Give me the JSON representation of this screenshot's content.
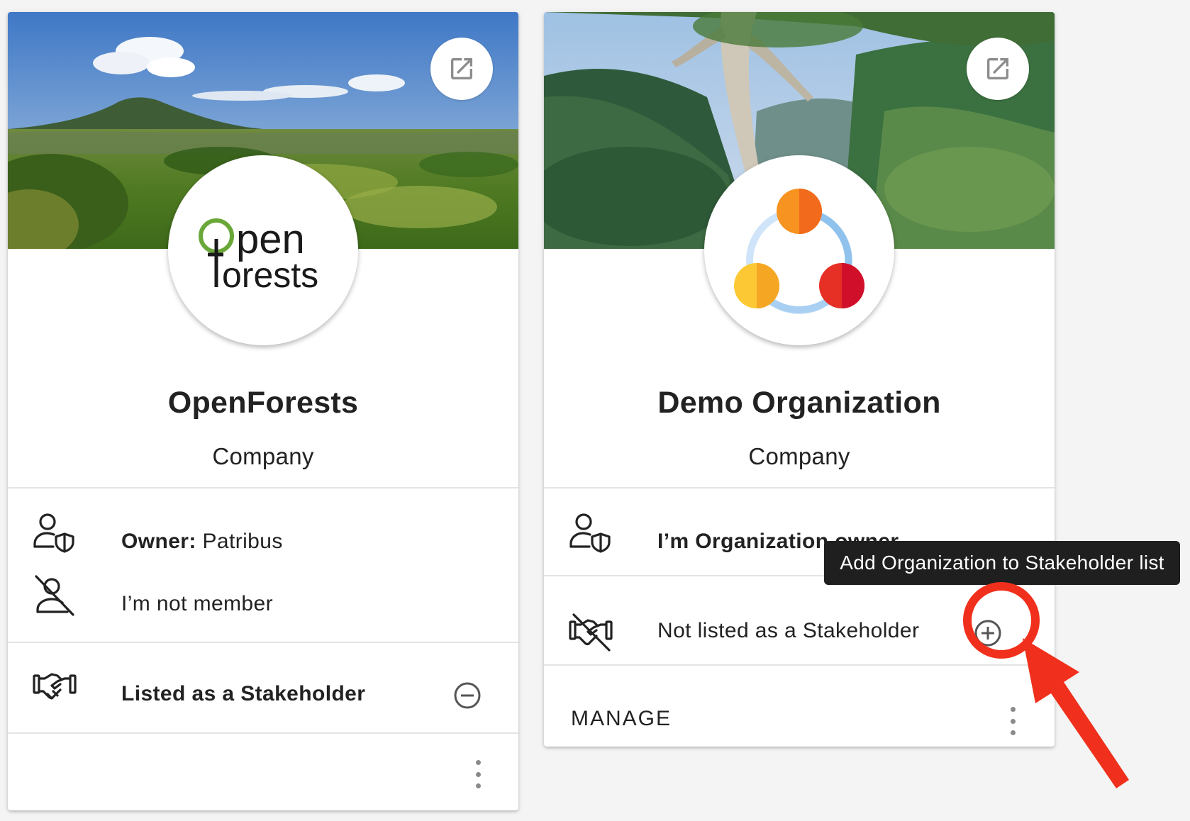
{
  "cards": [
    {
      "name": "OpenForests",
      "type": "Company",
      "logo_text": [
        "pen",
        "orests"
      ],
      "owner_label": "Owner:",
      "owner_value": "Patribus",
      "membership": "I’m not member",
      "stakeholder_status": "Listed as a Stakeholder",
      "stakeholder_action_icon": "remove-circle-icon"
    },
    {
      "name": "Demo Organization",
      "type": "Company",
      "owner_text": "I’m Organization owner",
      "stakeholder_status": "Not listed as a Stakeholder",
      "stakeholder_action_icon": "add-circle-icon",
      "manage_label": "MANAGE"
    }
  ],
  "tooltip": "Add Organization to Stakeholder list",
  "colors": {
    "tooltip_bg": "#1f1f1f",
    "annotation_red": "#f0301c",
    "openforests_green": "#6aa739",
    "logo_orange": "#f79321",
    "logo_red": "#e63025",
    "logo_yellow": "#fcc934",
    "logo_ring_blue": "#90c2ee"
  }
}
